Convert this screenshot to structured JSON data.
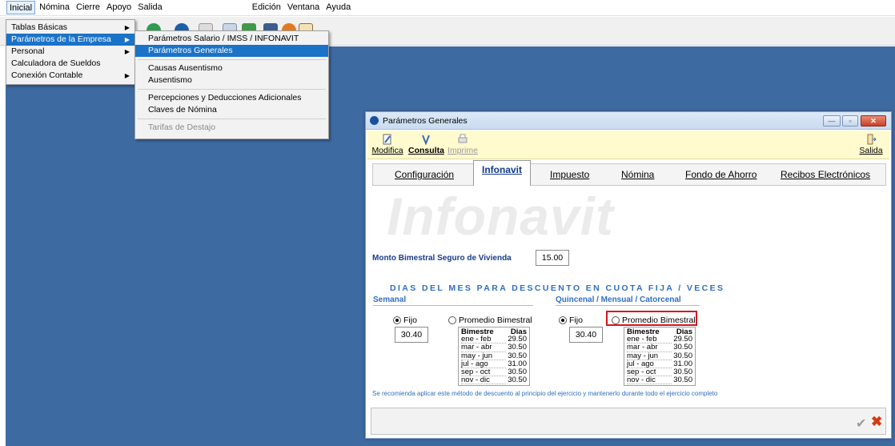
{
  "menubar": {
    "items": [
      "Inicial",
      "Nómina",
      "Cierre",
      "Apoyo",
      "Salida"
    ],
    "right_items": [
      "Edición",
      "Ventana",
      "Ayuda"
    ]
  },
  "menu_inicial": {
    "items": [
      {
        "label": "Tablas Básicas",
        "has_sub": true
      },
      {
        "label": "Parámetros de la Empresa",
        "has_sub": true
      },
      {
        "label": "Personal",
        "has_sub": true
      },
      {
        "label": "Calculadora de Sueldos",
        "has_sub": false
      },
      {
        "label": "Conexión Contable",
        "has_sub": true
      }
    ]
  },
  "menu_parametros": {
    "items": [
      "Parámetros Salario / IMSS / INFONAVIT",
      "Parámetros Generales",
      "Causas Ausentismo",
      "Ausentismo",
      "Percepciones y Deducciones Adicionales",
      "Claves de Nómina",
      "Tarifas de Destajo"
    ]
  },
  "dialog": {
    "title": "Parámetros Generales",
    "toolbar": {
      "modifica": "Modifica",
      "consulta": "Consulta",
      "imprime": "Imprime",
      "salida": "Salida"
    },
    "tabs": [
      "Configuración",
      "Infonavit",
      "Impuesto",
      "Nómina",
      "Fondo de Ahorro",
      "Recibos Electrónicos"
    ],
    "active_tab": "Infonavit",
    "watermark": "Infonavit",
    "monto_label": "Monto Bimestral Seguro de Vivienda",
    "monto_value": "15.00",
    "section_title": "DIAS DEL MES PARA DESCUENTO EN CUOTA FIJA / VECES",
    "semanal": {
      "title": "Semanal",
      "radio_fijo": "Fijo",
      "radio_promedio": "Promedio Bimestral",
      "fijo_selected": true,
      "fijo_value": "30.40"
    },
    "quincenal": {
      "title": "Quincenal / Mensual / Catorcenal",
      "radio_fijo": "Fijo",
      "radio_promedio": "Promedio Bimestral",
      "fijo_selected": true,
      "fijo_value": "30.40"
    },
    "bimestre_table": {
      "headers": [
        "Bimestre",
        "Dias"
      ],
      "rows": [
        [
          "ene - feb",
          "29.50"
        ],
        [
          "mar - abr",
          "30.50"
        ],
        [
          "may - jun",
          "30.50"
        ],
        [
          "jul - ago",
          "31.00"
        ],
        [
          "sep - oct",
          "30.50"
        ],
        [
          "nov - dic",
          "30.50"
        ]
      ]
    },
    "footnote": "Se recomienda aplicar este método de descuento al principio del ejercicio y mantenerlo durante todo el ejercicio completo"
  }
}
